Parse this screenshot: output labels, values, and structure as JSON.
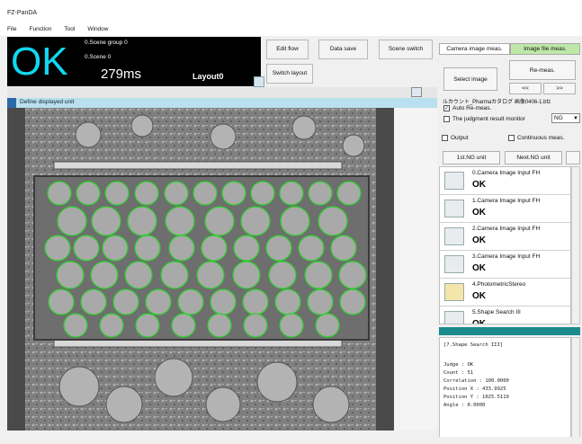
{
  "app": {
    "title": "FZ-PanDA"
  },
  "menu": [
    "File",
    "Function",
    "Tool",
    "Window"
  ],
  "status": {
    "judgement": "OK",
    "scene_group": "0.Scene group 0",
    "scene": "0.Scene 0",
    "time": "279ms",
    "layout": "Layout0"
  },
  "toolbar": {
    "edit_flow": "Edit flow",
    "data_save": "Data save",
    "scene_switch": "Scene switch",
    "switch_layout": "Switch layout"
  },
  "viewer": {
    "header": "Define displayed unit"
  },
  "right_panel": {
    "tab_camera": "Camera image meas.",
    "tab_file": "Image file meas.",
    "select_image": "Select image",
    "re_meas": "Re-meas.",
    "prev": "<<",
    "next": ">>",
    "file_path": "ルカウント_Pharmaカタログ 画像0406-1.bfz",
    "auto_remeas": "Auto Re-meas.",
    "judgment_monitor": "The judgment result monitor",
    "judgment_value": "NG",
    "output": "Output",
    "continuous": "Continuous meas.",
    "first_ng": "1st.NG unit",
    "next_ng": "Next.NG unit"
  },
  "units": [
    {
      "name": "0.Camera Image Input FH",
      "result": "OK",
      "icon": "camera-icon"
    },
    {
      "name": "1.Camera Image Input FH",
      "result": "OK",
      "icon": "camera-icon"
    },
    {
      "name": "2.Camera Image Input FH",
      "result": "OK",
      "icon": "camera-icon"
    },
    {
      "name": "3.Camera Image Input FH",
      "result": "OK",
      "icon": "camera-icon"
    },
    {
      "name": "4.PhotometricStereo",
      "result": "OK",
      "icon": "photometric-icon"
    },
    {
      "name": "5.Shape Search III",
      "result": "OK",
      "icon": "shape-search-icon"
    }
  ],
  "detail": {
    "title": "[7.Shape Search III]",
    "lines": [
      "Judge : OK",
      "Count : 51",
      "Correlation : 100.0000",
      "Position X : 433.9925",
      "Position Y : 1025.5119",
      "Angle : 0.0000"
    ]
  },
  "colors": {
    "ok": "#10d8f0",
    "match": "#2bd12b",
    "accent": "#1b8a8c"
  }
}
